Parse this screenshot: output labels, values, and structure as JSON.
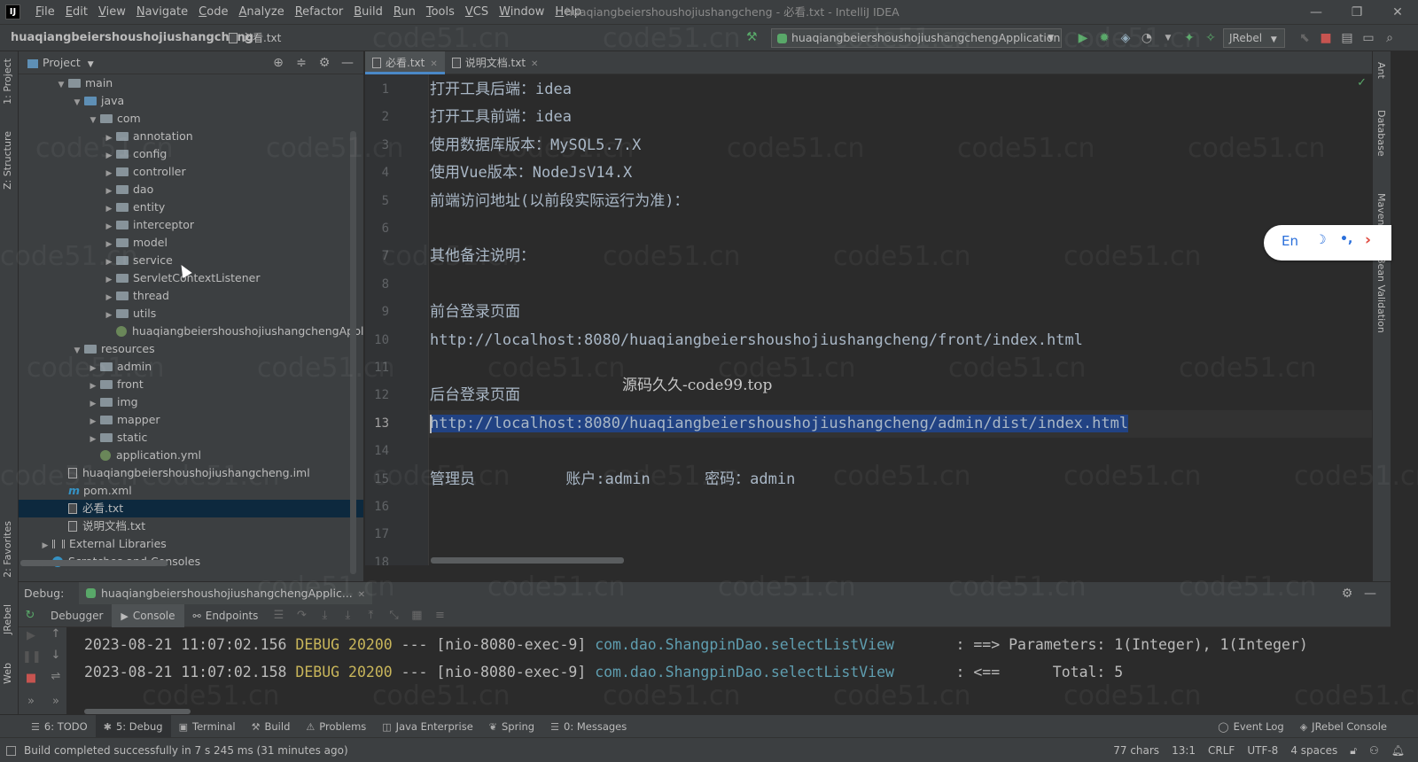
{
  "menubar": {
    "items": [
      "File",
      "Edit",
      "View",
      "Navigate",
      "Code",
      "Analyze",
      "Refactor",
      "Build",
      "Run",
      "Tools",
      "VCS",
      "Window",
      "Help"
    ],
    "window_title": "huaqiangbeiershoushojiushangcheng - 必看.txt - IntelliJ IDEA",
    "logo": "IJ"
  },
  "navbar": {
    "project": "huaqiangbeiershoushojiushangcheng",
    "file": "必看.txt",
    "run_config": "huaqiangbeiershoushojiushangchengApplication",
    "jrebel": "JRebel"
  },
  "left_strip": {
    "project_tab": "1: Project",
    "structure_tab": "Z: Structure",
    "favorites_tab": "2: Favorites",
    "jrebel_tab": "JRebel",
    "web_tab": "Web"
  },
  "right_strip": {
    "ant": "Ant",
    "database": "Database",
    "maven": "Maven",
    "bean_validation": "Bean Validation"
  },
  "project_panel": {
    "title": "Project",
    "tree": [
      {
        "label": "main",
        "depth": 2,
        "arrow": "▼",
        "icon": "folder"
      },
      {
        "label": "java",
        "depth": 3,
        "arrow": "▼",
        "icon": "folder-blue"
      },
      {
        "label": "com",
        "depth": 4,
        "arrow": "▼",
        "icon": "folder"
      },
      {
        "label": "annotation",
        "depth": 5,
        "arrow": "▶",
        "icon": "folder"
      },
      {
        "label": "config",
        "depth": 5,
        "arrow": "▶",
        "icon": "folder"
      },
      {
        "label": "controller",
        "depth": 5,
        "arrow": "▶",
        "icon": "folder"
      },
      {
        "label": "dao",
        "depth": 5,
        "arrow": "▶",
        "icon": "folder"
      },
      {
        "label": "entity",
        "depth": 5,
        "arrow": "▶",
        "icon": "folder"
      },
      {
        "label": "interceptor",
        "depth": 5,
        "arrow": "▶",
        "icon": "folder"
      },
      {
        "label": "model",
        "depth": 5,
        "arrow": "▶",
        "icon": "folder"
      },
      {
        "label": "service",
        "depth": 5,
        "arrow": "▶",
        "icon": "folder"
      },
      {
        "label": "ServletContextListener",
        "depth": 5,
        "arrow": "▶",
        "icon": "folder"
      },
      {
        "label": "thread",
        "depth": 5,
        "arrow": "▶",
        "icon": "folder"
      },
      {
        "label": "utils",
        "depth": 5,
        "arrow": "▶",
        "icon": "folder"
      },
      {
        "label": "huaqiangbeiershoushojiushangchengApplication",
        "depth": 5,
        "arrow": "",
        "icon": "spring"
      },
      {
        "label": "resources",
        "depth": 3,
        "arrow": "▼",
        "icon": "folder"
      },
      {
        "label": "admin",
        "depth": 4,
        "arrow": "▶",
        "icon": "folder"
      },
      {
        "label": "front",
        "depth": 4,
        "arrow": "▶",
        "icon": "folder"
      },
      {
        "label": "img",
        "depth": 4,
        "arrow": "▶",
        "icon": "folder"
      },
      {
        "label": "mapper",
        "depth": 4,
        "arrow": "▶",
        "icon": "folder"
      },
      {
        "label": "static",
        "depth": 4,
        "arrow": "▶",
        "icon": "folder"
      },
      {
        "label": "application.yml",
        "depth": 4,
        "arrow": "",
        "icon": "spring"
      },
      {
        "label": "huaqiangbeiershoushojiushangcheng.iml",
        "depth": 2,
        "arrow": "",
        "icon": "file"
      },
      {
        "label": "pom.xml",
        "depth": 2,
        "arrow": "",
        "icon": "maven"
      },
      {
        "label": "必看.txt",
        "depth": 2,
        "arrow": "",
        "icon": "file",
        "selected": true
      },
      {
        "label": "说明文档.txt",
        "depth": 2,
        "arrow": "",
        "icon": "file"
      },
      {
        "label": "External Libraries",
        "depth": 1,
        "arrow": "▶",
        "icon": "lib"
      },
      {
        "label": "Scratches and Consoles",
        "depth": 1,
        "arrow": "▶",
        "icon": "scratch"
      }
    ]
  },
  "editor": {
    "tabs": [
      {
        "label": "必看.txt",
        "active": true
      },
      {
        "label": "说明文档.txt",
        "active": false
      }
    ],
    "current_line": 13,
    "lines": [
      "打开工具后端：idea",
      "打开工具前端：idea",
      "使用数据库版本：MySQL5.7.X",
      "使用Vue版本：NodeJsV14.X",
      "前端访问地址(以前段实际运行为准)：",
      "",
      "其他备注说明：",
      "",
      "前台登录页面",
      "http://localhost:8080/huaqiangbeiershoushojiushangcheng/front/index.html",
      "",
      "后台登录页面",
      "http://localhost:8080/huaqiangbeiershoushojiushangcheng/admin/dist/index.html",
      "",
      "管理员          账户:admin      密码：admin",
      "",
      "",
      ""
    ],
    "overlay_text": "源码久久-code99.top"
  },
  "ime": {
    "lang": "En",
    "moon": "☽",
    "punct": "•,",
    "arrow": "›"
  },
  "debug": {
    "label": "Debug:",
    "session": "huaqiangbeiershoushojiushangchengApplic...",
    "tabs": [
      {
        "label": "Debugger",
        "active": false,
        "glyph": ""
      },
      {
        "label": "Console",
        "active": true,
        "glyph": "▶"
      },
      {
        "label": "Endpoints",
        "active": false,
        "glyph": "⚯"
      }
    ],
    "console_lines": [
      {
        "ts": "2023-08-21 11:07:02.156",
        "level": "DEBUG",
        "pid": "20200",
        "mid": " --- [nio-8080-exec-9] ",
        "logger": "com.dao.ShangpinDao.selectListView",
        "msg": "       : ==> Parameters: 1(Integer), 1(Integer)"
      },
      {
        "ts": "2023-08-21 11:07:02.158",
        "level": "DEBUG",
        "pid": "20200",
        "mid": " --- [nio-8080-exec-9] ",
        "logger": "com.dao.ShangpinDao.selectListView",
        "msg": "       : <==      Total: 5"
      }
    ]
  },
  "toolwindows": {
    "left": [
      {
        "label": "6: TODO",
        "glyph": "☰",
        "active": false
      },
      {
        "label": "5: Debug",
        "glyph": "✱",
        "active": true
      },
      {
        "label": "Terminal",
        "glyph": "▣",
        "active": false
      },
      {
        "label": "Build",
        "glyph": "⚒",
        "active": false
      },
      {
        "label": "Problems",
        "glyph": "⚠",
        "active": false
      },
      {
        "label": "Java Enterprise",
        "glyph": "◫",
        "active": false
      },
      {
        "label": "Spring",
        "glyph": "❦",
        "active": false
      },
      {
        "label": "0: Messages",
        "glyph": "☰",
        "active": false
      }
    ],
    "right": [
      {
        "label": "Event Log",
        "glyph": "◯"
      },
      {
        "label": "JRebel Console",
        "glyph": "◈"
      }
    ]
  },
  "status": {
    "message": "Build completed successfully in 7 s 245 ms (31 minutes ago)",
    "chars": "77 chars",
    "position": "13:1",
    "line_sep": "CRLF",
    "encoding": "UTF-8",
    "indent": "4 spaces"
  },
  "colors": {
    "accent": "#4a88c7",
    "selection": "#214283",
    "success": "#59a869",
    "debug_level": "#c8b55a",
    "logger": "#5f9eb0"
  }
}
